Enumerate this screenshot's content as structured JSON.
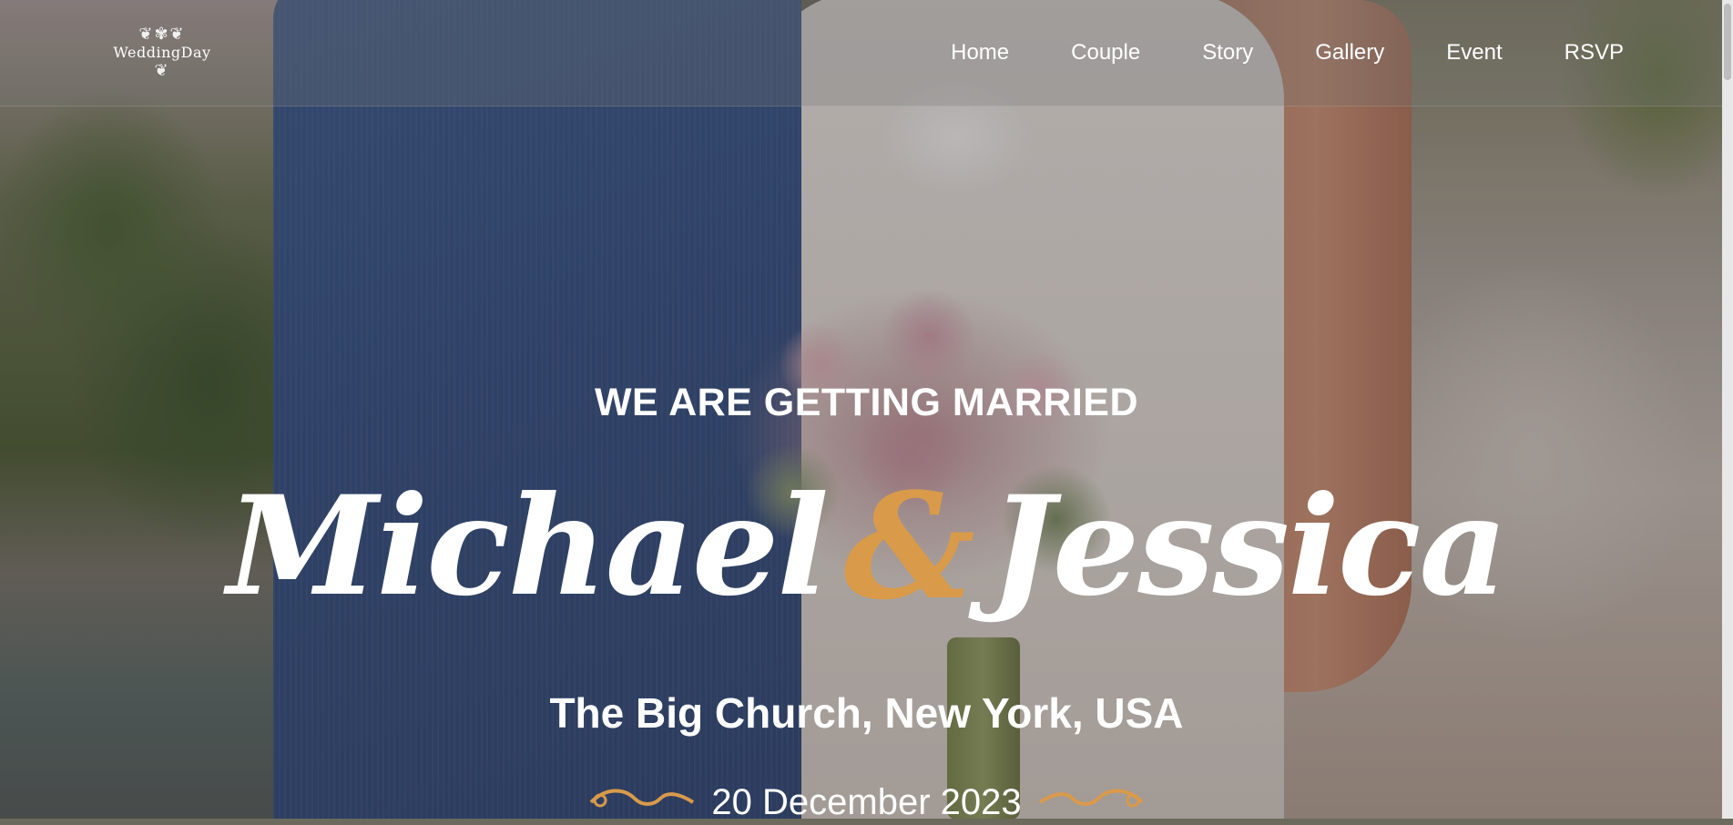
{
  "logo": {
    "text": "WeddingDay",
    "ornament": "❦✾❦"
  },
  "nav": {
    "items": [
      "Home",
      "Couple",
      "Story",
      "Gallery",
      "Event",
      "RSVP"
    ]
  },
  "hero": {
    "tagline": "WE ARE GETTING MARRIED",
    "name_one": "Michael",
    "ampersand": "&",
    "name_two": "Jessica",
    "location": "The Big Church, New York, USA",
    "date": "20 December 2023"
  },
  "colors": {
    "accent": "#d99a4a",
    "text": "#ffffff"
  }
}
